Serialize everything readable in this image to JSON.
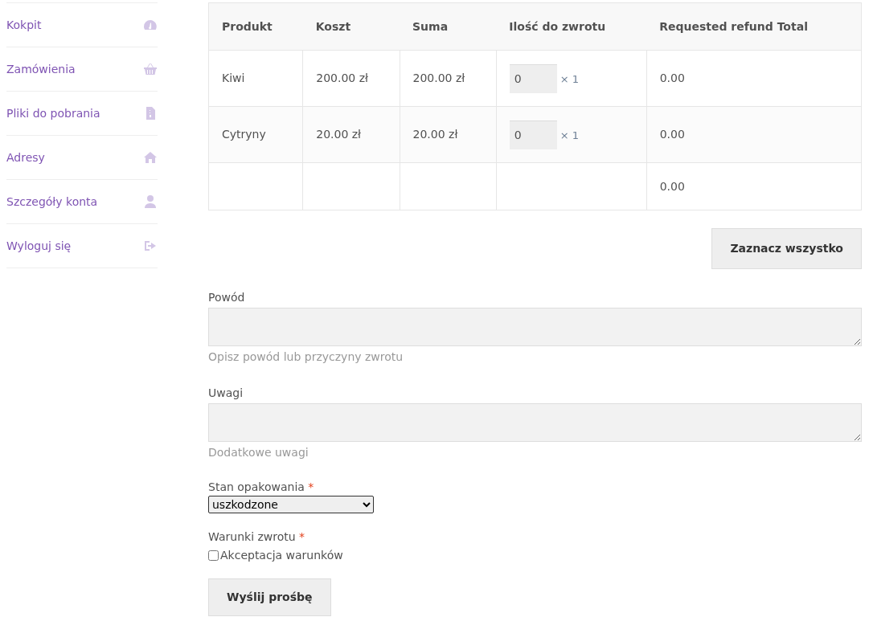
{
  "sidebar": {
    "items": [
      {
        "label": "Kokpit"
      },
      {
        "label": "Zamówienia"
      },
      {
        "label": "Pliki do pobrania"
      },
      {
        "label": "Adresy"
      },
      {
        "label": "Szczegóły konta"
      },
      {
        "label": "Wyloguj się"
      }
    ]
  },
  "table": {
    "columns": [
      "Produkt",
      "Koszt",
      "Suma",
      "Ilość do zwrotu",
      "Requested refund Total"
    ],
    "rows": [
      {
        "product": "Kiwi",
        "cost": "200.00 zł",
        "sum": "200.00 zł",
        "qty": "0",
        "max": "× 1",
        "total": "0.00"
      },
      {
        "product": "Cytryny",
        "cost": "20.00 zł",
        "sum": "20.00 zł",
        "qty": "0",
        "max": "× 1",
        "total": "0.00"
      }
    ],
    "footer_total": "0.00"
  },
  "select_all_button": "Zaznacz wszystko",
  "fields": [
    {
      "label": "Powód",
      "hint": "Opisz powód lub przyczyny zwrotu"
    },
    {
      "label": "Uwagi",
      "hint": "Dodatkowe uwagi"
    }
  ],
  "packaging": {
    "label": "Stan opakowania",
    "required_mark": "*",
    "value": "uszkodzone"
  },
  "terms": {
    "label": "Warunki zwrotu",
    "required_mark": "*",
    "checkbox_label": "Akceptacja warunków",
    "checked": false
  },
  "submit_button": "Wyślij prośbę"
}
